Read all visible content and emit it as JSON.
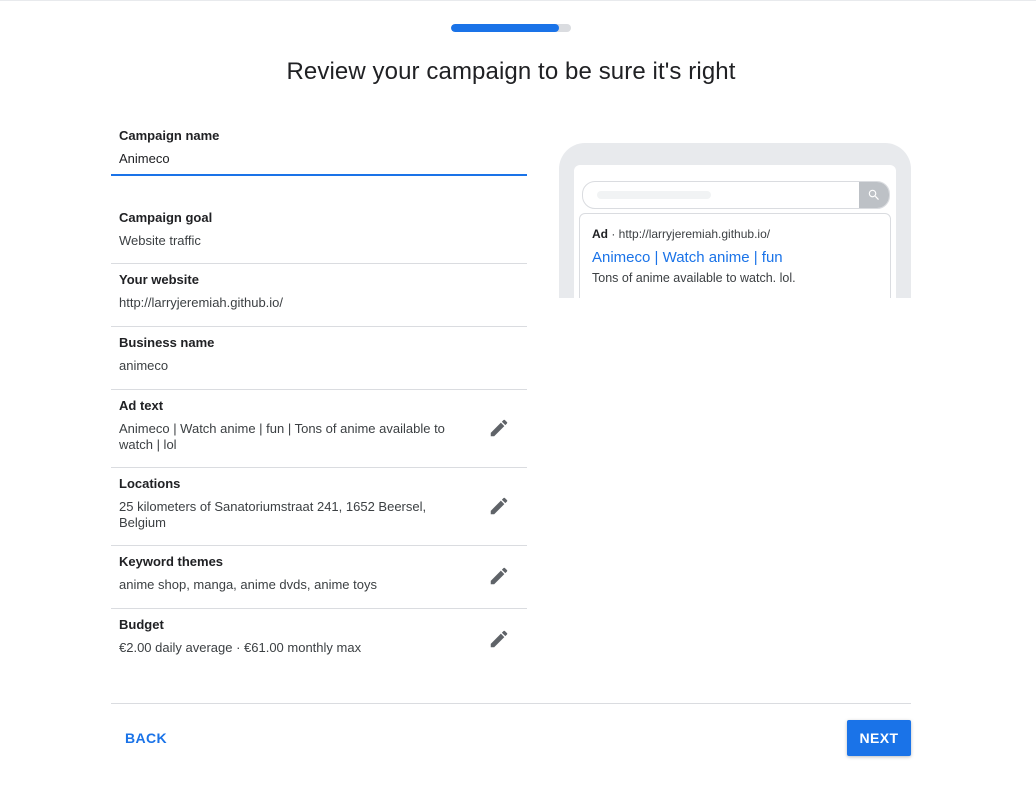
{
  "progress": {
    "fraction": 0.9
  },
  "page": {
    "title": "Review your campaign to be sure it's right"
  },
  "campaign_name": {
    "label": "Campaign name",
    "value": "Animeco"
  },
  "summary": [
    {
      "label": "Campaign goal",
      "value": "Website traffic",
      "editable": false
    },
    {
      "label": "Your website",
      "value": "http://larryjeremiah.github.io/",
      "editable": false
    },
    {
      "label": "Business name",
      "value": "animeco",
      "editable": false
    },
    {
      "label": "Ad text",
      "value": "Animeco | Watch anime | fun | Tons of anime available to watch | lol",
      "editable": true
    },
    {
      "label": "Locations",
      "value": "25 kilometers of Sanatoriumstraat 241, 1652 Beersel, Belgium",
      "editable": true
    },
    {
      "label": "Keyword themes",
      "value": "anime shop, manga, anime dvds, anime toys",
      "editable": true
    },
    {
      "label": "Budget",
      "value": "€2.00 daily average · €61.00 monthly max",
      "editable": true
    }
  ],
  "preview": {
    "ad_label": "Ad",
    "url": "· http://larryjeremiah.github.io/",
    "headline": "Animeco | Watch anime | fun",
    "description": "Tons of anime available to watch. lol."
  },
  "footer": {
    "back_label": "BACK",
    "next_label": "NEXT"
  },
  "colors": {
    "accent": "#1a73e8",
    "icon": "#5f6368",
    "divider": "#dadce0"
  },
  "icons": {
    "edit": "pencil-icon",
    "search": "search-icon"
  }
}
